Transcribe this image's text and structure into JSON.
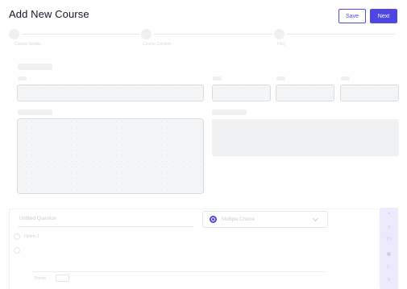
{
  "header": {
    "title": "Add New Course",
    "save_label": "Save",
    "next_label": "Next"
  },
  "stepper": {
    "steps": [
      {
        "label": "Course Details"
      },
      {
        "label": "Course Content"
      },
      {
        "label": "FAQ"
      }
    ]
  },
  "editor": {
    "question_placeholder": "Untitled Question",
    "type_select": "Multiple Choice",
    "option_1": "Option 1",
    "score_label": "Points"
  },
  "toolbar": {
    "items": [
      "+",
      "⇪",
      "Tт",
      "▣",
      "▷",
      "≡"
    ]
  },
  "colors": {
    "accent": "#4f46e5",
    "toolbar_bg": "#eceafc"
  }
}
